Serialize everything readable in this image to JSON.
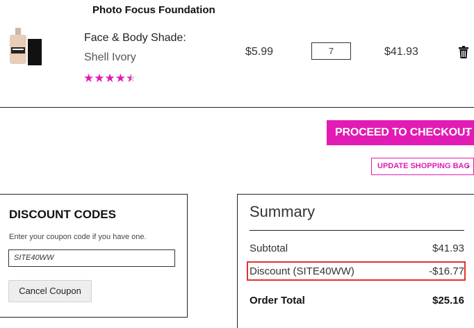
{
  "product": {
    "title": "Photo Focus Foundation",
    "name_line1": "Face & Body Shade:",
    "name_line2": "Shell Ivory",
    "rating": 4.5,
    "stars_max": 5,
    "price": "$5.99",
    "quantity": "7",
    "line_total": "$41.93"
  },
  "actions": {
    "checkout_label": "PROCEED TO CHECKOUT",
    "update_label": "UPDATE SHOPPING BAG",
    "chevron": "›"
  },
  "discount": {
    "title": "DISCOUNT CODES",
    "hint": "Enter your coupon code if you have one.",
    "coupon_value": "SITE40WW",
    "cancel_label": "Cancel Coupon"
  },
  "summary": {
    "title": "Summary",
    "subtotal_label": "Subtotal",
    "subtotal_value": "$41.93",
    "discount_label": "Discount (SITE40WW)",
    "discount_value": "-$16.77",
    "total_label": "Order Total",
    "total_value": "$25.16"
  },
  "colors": {
    "accent": "#e21bb4",
    "highlight": "#e0322f"
  },
  "icons": [
    "foundation-bottle-icon",
    "star-icon",
    "trash-icon",
    "chevron-right-icon"
  ]
}
